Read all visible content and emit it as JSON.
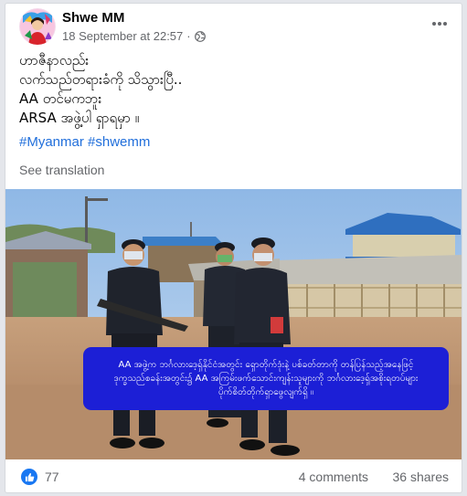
{
  "post": {
    "author": "Shwe MM",
    "timestamp": "18 September at 22:57",
    "separator": "·",
    "privacy_icon": "globe-icon",
    "menu_icon": "more-options-icon",
    "text_lines": [
      "ဟာဇီနာလည်း",
      "လက်သည်တရားခံကို သိသွားပြီ..",
      "AA တင်မကဘူး",
      "ARSA အဖွဲ့ပါ ရှာရမှာ ။"
    ],
    "hashtags": [
      "#Myanmar",
      "#shwemm"
    ],
    "see_translation": "See translation"
  },
  "image": {
    "caption_lines": [
      "AA အဖွဲ့က ဘင်္ဂလားဒေ့ရှ်နိုင်ငံအတွင်း ရှောတိုက်ဒုံးနဲ့ ပစ်ခတ်တာကို တန်ပြန်သည့်အနေဖြင့်",
      "ဒုက္ခသည်စခန်းအတွင်း၌ AA အကြမ်းဖက်သောင်းကျန်းသူများကို ဘင်္ဂလားဒေ့ရှ်အစိုးရတပ်များ",
      "ပိုက်စိတ်တိုက်ရှာဖွေလျက်ရှိ ။"
    ],
    "caption_bg": "#1c1fd6"
  },
  "footer": {
    "like_icon": "thumbs-up-icon",
    "like_count": "77",
    "comments": "4 comments",
    "shares": "36 shares",
    "accent": "#1877f2"
  }
}
